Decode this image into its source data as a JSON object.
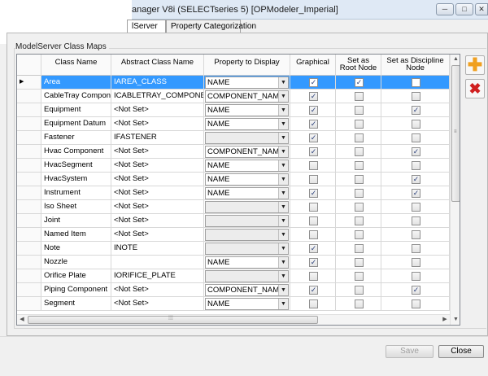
{
  "window": {
    "title": "anager V8i (SELECTseries 5) [OPModeler_Imperial]",
    "minimize_glyph": "─",
    "maximize_glyph": "□",
    "close_glyph": "✕"
  },
  "tabs": [
    {
      "label": "lServer",
      "active": true
    },
    {
      "label": "Property Categorization",
      "active": false
    }
  ],
  "group": {
    "label": "ModelServer Class Maps"
  },
  "grid": {
    "columns": {
      "class_name": "Class Name",
      "abstract_class_name": "Abstract Class Name",
      "property_to_display": "Property to Display",
      "graphical": "Graphical",
      "root_node": "Set as\nRoot Node",
      "discipline_node": "Set as Discipline\nNode"
    },
    "selected_row_marker": "▶",
    "rows": [
      {
        "class_name": "Area",
        "abstract": "IAREA_CLASS",
        "property": "NAME",
        "graphical": true,
        "root": true,
        "discipline": false,
        "selected": true
      },
      {
        "class_name": "CableTray Component",
        "abstract": "ICABLETRAY_COMPONENT",
        "property": "COMPONENT_NAME",
        "graphical": true,
        "root": false,
        "discipline": false,
        "selected": false
      },
      {
        "class_name": "Equipment",
        "abstract": "<Not Set>",
        "property": "NAME",
        "graphical": true,
        "root": false,
        "discipline": true,
        "selected": false
      },
      {
        "class_name": "Equipment Datum",
        "abstract": "<Not Set>",
        "property": "NAME",
        "graphical": true,
        "root": false,
        "discipline": false,
        "selected": false
      },
      {
        "class_name": "Fastener",
        "abstract": "IFASTENER",
        "property": "",
        "graphical": true,
        "root": false,
        "discipline": false,
        "selected": false
      },
      {
        "class_name": "Hvac Component",
        "abstract": "<Not Set>",
        "property": "COMPONENT_NAME",
        "graphical": true,
        "root": false,
        "discipline": true,
        "selected": false
      },
      {
        "class_name": "HvacSegment",
        "abstract": "<Not Set>",
        "property": "NAME",
        "graphical": false,
        "root": false,
        "discipline": false,
        "selected": false
      },
      {
        "class_name": "HvacSystem",
        "abstract": "<Not Set>",
        "property": "NAME",
        "graphical": false,
        "root": false,
        "discipline": true,
        "selected": false
      },
      {
        "class_name": "Instrument",
        "abstract": "<Not Set>",
        "property": "NAME",
        "graphical": true,
        "root": false,
        "discipline": true,
        "selected": false
      },
      {
        "class_name": "Iso Sheet",
        "abstract": "<Not Set>",
        "property": "",
        "graphical": false,
        "root": false,
        "discipline": false,
        "selected": false
      },
      {
        "class_name": "Joint",
        "abstract": "<Not Set>",
        "property": "",
        "graphical": false,
        "root": false,
        "discipline": false,
        "selected": false
      },
      {
        "class_name": "Named Item",
        "abstract": "<Not Set>",
        "property": "",
        "graphical": false,
        "root": false,
        "discipline": false,
        "selected": false
      },
      {
        "class_name": "Note",
        "abstract": "INOTE",
        "property": "",
        "graphical": true,
        "root": false,
        "discipline": false,
        "selected": false
      },
      {
        "class_name": "Nozzle",
        "abstract": "",
        "property": "NAME",
        "graphical": true,
        "root": false,
        "discipline": false,
        "selected": false
      },
      {
        "class_name": "Orifice Plate",
        "abstract": "IORIFICE_PLATE",
        "property": "",
        "graphical": false,
        "root": false,
        "discipline": false,
        "selected": false
      },
      {
        "class_name": "Piping Component",
        "abstract": "<Not Set>",
        "property": "COMPONENT_NAME",
        "graphical": true,
        "root": false,
        "discipline": true,
        "selected": false
      },
      {
        "class_name": "Segment",
        "abstract": "<Not Set>",
        "property": "NAME",
        "graphical": false,
        "root": false,
        "discipline": false,
        "selected": false
      }
    ]
  },
  "buttons": {
    "save": "Save",
    "close": "Close",
    "add_glyph": "✚",
    "delete_glyph": "✖",
    "check_glyph": "✓",
    "dropdown_glyph": "▼"
  },
  "colors": {
    "selection": "#3399ff",
    "add_icon": "#f0a020",
    "delete_icon": "#d02020"
  }
}
